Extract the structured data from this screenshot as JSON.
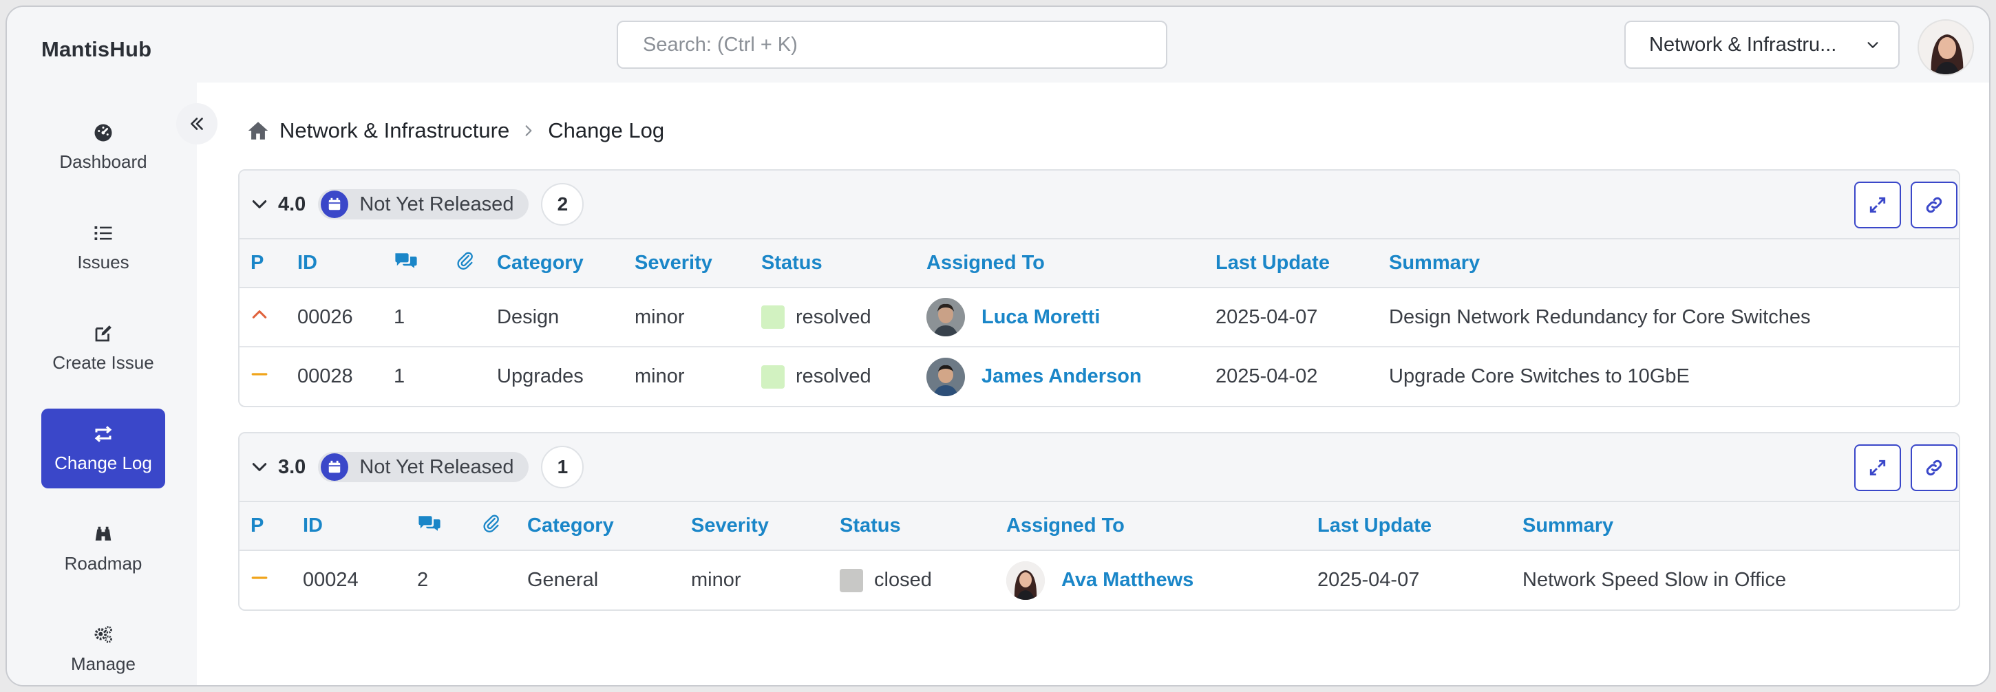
{
  "app": {
    "brand": "MantisHub"
  },
  "header": {
    "search_placeholder": "Search: (Ctrl + K)",
    "project_selected": "Network & Infrastru..."
  },
  "sidebar": {
    "items": [
      {
        "label": "Dashboard",
        "icon": "dashboard-icon"
      },
      {
        "label": "Issues",
        "icon": "list-icon"
      },
      {
        "label": "Create Issue",
        "icon": "edit-icon"
      },
      {
        "label": "Change Log",
        "icon": "sync-icon",
        "active": true
      },
      {
        "label": "Roadmap",
        "icon": "binoculars-icon"
      },
      {
        "label": "Manage",
        "icon": "gears-icon"
      }
    ]
  },
  "breadcrumb": {
    "project": "Network & Infrastructure",
    "page": "Change Log"
  },
  "columns": {
    "p": "P",
    "id": "ID",
    "category": "Category",
    "severity": "Severity",
    "status": "Status",
    "assigned": "Assigned To",
    "updated": "Last Update",
    "summary": "Summary"
  },
  "versions": [
    {
      "version": "4.0",
      "release_status": "Not Yet Released",
      "count": "2",
      "issues": [
        {
          "priority": "high",
          "id": "00026",
          "notes": "1",
          "category": "Design",
          "severity": "minor",
          "status": "resolved",
          "status_color": "#d2f2c1",
          "assignee": "Luca Moretti",
          "updated": "2025-04-07",
          "summary": "Design Network Redundancy for Core Switches"
        },
        {
          "priority": "normal",
          "id": "00028",
          "notes": "1",
          "category": "Upgrades",
          "severity": "minor",
          "status": "resolved",
          "status_color": "#d2f2c1",
          "assignee": "James Anderson",
          "updated": "2025-04-02",
          "summary": "Upgrade Core Switches to 10GbE"
        }
      ]
    },
    {
      "version": "3.0",
      "release_status": "Not Yet Released",
      "count": "1",
      "issues": [
        {
          "priority": "normal",
          "id": "00024",
          "notes": "2",
          "category": "General",
          "severity": "minor",
          "status": "closed",
          "status_color": "#c8c8c6",
          "assignee": "Ava Matthews",
          "updated": "2025-04-07",
          "summary": "Network Speed Slow in Office"
        }
      ]
    }
  ],
  "colors": {
    "accent": "#3a47c9",
    "link": "#1a86c8",
    "priority_high": "#e0623c",
    "priority_normal": "#f0a51c"
  }
}
